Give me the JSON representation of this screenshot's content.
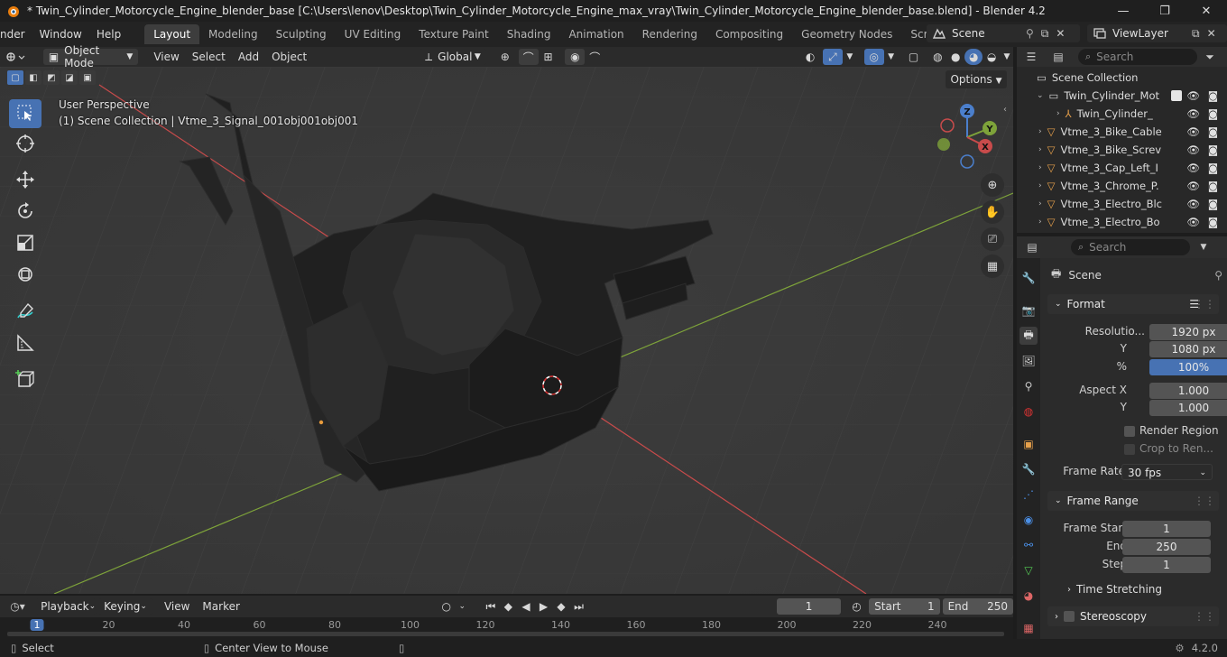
{
  "window": {
    "title": "* Twin_Cylinder_Motorcycle_Engine_blender_base [C:\\Users\\lenov\\Desktop\\Twin_Cylinder_Motorcycle_Engine_max_vray\\Twin_Cylinder_Motorcycle_Engine_blender_base.blend] - Blender 4.2",
    "minimize": "—",
    "maximize": "❐",
    "close": "✕"
  },
  "menu": {
    "items": [
      "nder",
      "Window",
      "Help"
    ]
  },
  "workspaces": {
    "tabs": [
      "Layout",
      "Modeling",
      "Sculpting",
      "UV Editing",
      "Texture Paint",
      "Shading",
      "Animation",
      "Rendering",
      "Compositing",
      "Geometry Nodes",
      "Scripting"
    ],
    "active": "Layout",
    "add": "+"
  },
  "scene": {
    "name": "Scene",
    "view_layer": "ViewLayer"
  },
  "viewport_header": {
    "mode": "Object Mode",
    "menus": [
      "View",
      "Select",
      "Add",
      "Object"
    ],
    "transform_orientation": "Global",
    "options_label": "Options"
  },
  "viewport": {
    "perspective_label": "User Perspective",
    "collection_label": "(1) Scene Collection | Vtme_3_Signal_001obj001obj001",
    "gizmo": {
      "x": "X",
      "y": "Y",
      "z": "Z"
    }
  },
  "outliner": {
    "search_placeholder": "Search",
    "root": "Scene Collection",
    "rows": [
      {
        "label": "Twin_Cylinder_Mot",
        "indent": 1,
        "type": "collection"
      },
      {
        "label": "Twin_Cylinder_",
        "indent": 2,
        "type": "empty"
      },
      {
        "label": "Vtme_3_Bike_Cable",
        "indent": 1,
        "type": "mesh"
      },
      {
        "label": "Vtme_3_Bike_Screv",
        "indent": 1,
        "type": "mesh"
      },
      {
        "label": "Vtme_3_Cap_Left_I",
        "indent": 1,
        "type": "mesh"
      },
      {
        "label": "Vtme_3_Chrome_P.",
        "indent": 1,
        "type": "mesh"
      },
      {
        "label": "Vtme_3_Electro_Blc",
        "indent": 1,
        "type": "mesh"
      },
      {
        "label": "Vtme_3_Electro_Bo",
        "indent": 1,
        "type": "mesh"
      }
    ]
  },
  "properties": {
    "search_placeholder": "Search",
    "context": "Scene",
    "format": {
      "title": "Format",
      "resolution_label": "Resolutio...",
      "resolution_x": "1920 px",
      "y_label": "Y",
      "resolution_y": "1080 px",
      "percent_label": "%",
      "percent": "100%",
      "aspect_x_label": "Aspect X",
      "aspect_x": "1.000",
      "aspect_y_label": "Y",
      "aspect_y": "1.000",
      "render_region": "Render Region",
      "crop": "Crop to Ren...",
      "frame_rate_label": "Frame Rate",
      "frame_rate": "30 fps"
    },
    "frame_range": {
      "title": "Frame Range",
      "start_label": "Frame Start",
      "start": "1",
      "end_label": "End",
      "end": "250",
      "step_label": "Step",
      "step": "1",
      "time_stretching": "Time Stretching"
    },
    "stereoscopy": "Stereoscopy"
  },
  "timeline": {
    "menus": [
      "Playback",
      "Keying",
      "View",
      "Marker"
    ],
    "current_frame": "1",
    "start_label": "Start",
    "start": "1",
    "end_label": "End",
    "end": "250",
    "ruler": [
      "1",
      "20",
      "40",
      "60",
      "80",
      "100",
      "120",
      "140",
      "160",
      "180",
      "200",
      "220",
      "240"
    ]
  },
  "statusbar": {
    "select": "Select",
    "center_view": "Center View to Mouse",
    "version": "4.2.0"
  },
  "colors": {
    "accent": "#4772b3",
    "x_axis": "#c84b4b",
    "y_axis": "#7ea33a",
    "z_axis": "#4b7fcc",
    "mesh_icon": "#e6a04b"
  }
}
